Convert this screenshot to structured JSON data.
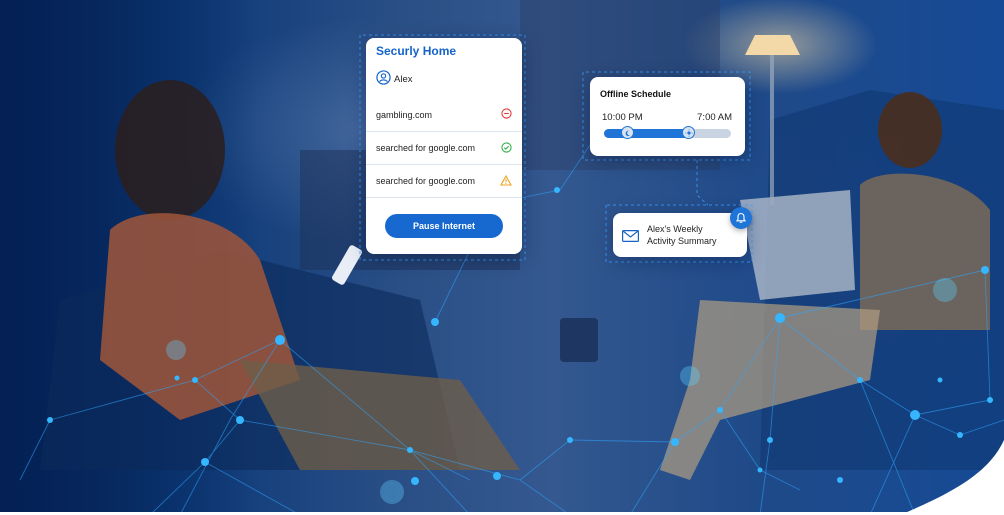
{
  "home_card": {
    "title": "Securly Home",
    "profile_name": "Alex",
    "rows": [
      {
        "text": "gambling.com",
        "status_icon": "blocked-icon",
        "status_color": "#e23b3b"
      },
      {
        "text": "searched for google.com",
        "status_icon": "check-circle-icon",
        "status_color": "#35b04a"
      },
      {
        "text": "searched for google.com",
        "status_icon": "warning-icon",
        "status_color": "#f0a21f"
      }
    ],
    "pause_button_label": "Pause Internet"
  },
  "schedule_card": {
    "title": "Offline Schedule",
    "start_time": "10:00 PM",
    "end_time": "7:00 AM",
    "start_icon": "moon-icon",
    "end_icon": "sun-icon"
  },
  "report_card": {
    "line1": "Alex's Weekly",
    "line2": "Activity Summary",
    "icon": "mail-icon",
    "badge_icon": "bell-icon"
  },
  "colors": {
    "accent": "#1769d0",
    "navy": "#07285c"
  }
}
